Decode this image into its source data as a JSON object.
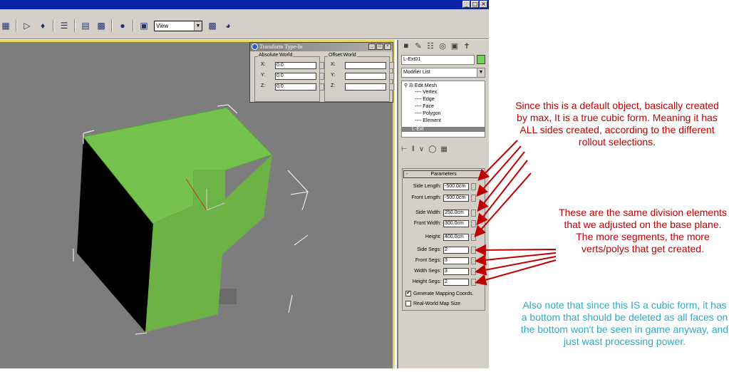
{
  "window": {
    "controls": [
      "_",
      "□",
      "×"
    ]
  },
  "toolbar": {
    "view_dropdown": "View"
  },
  "transform_dialog": {
    "title": "Transform Type-In",
    "absolute_group": "Absolute:World",
    "offset_group": "Offset:World",
    "absolute": [
      {
        "axis": "X:",
        "value": "0.0"
      },
      {
        "axis": "Y:",
        "value": "0.0"
      },
      {
        "axis": "Z:",
        "value": "0.0"
      }
    ],
    "offset": [
      {
        "axis": "X:",
        "value": ""
      },
      {
        "axis": "Y:",
        "value": ""
      },
      {
        "axis": "Z:",
        "value": ""
      }
    ]
  },
  "command_panel": {
    "object_name": "L-Ext01",
    "object_color": "#76d15a",
    "modifier_list": "Modifier List",
    "stack": {
      "edit_mesh": "Edit Mesh",
      "sub_objects": [
        "Vertex",
        "Edge",
        "Face",
        "Polygon",
        "Element"
      ],
      "base_object": "L-Ext"
    },
    "parameters_title": "Parameters",
    "parameters": [
      {
        "label": "Side Length:",
        "value": "-500.0cm"
      },
      {
        "label": "Front Length:",
        "value": "-500.0cm"
      },
      {
        "label": "Side Width:",
        "value": "250.0cm"
      },
      {
        "label": "Front Width:",
        "value": "300.0cm"
      },
      {
        "label": "Height:",
        "value": "400.0cm"
      },
      {
        "label": "Side Segs:",
        "value": "2"
      },
      {
        "label": "Front Segs:",
        "value": "3"
      },
      {
        "label": "Width Segs:",
        "value": "3"
      },
      {
        "label": "Height Segs:",
        "value": "2"
      }
    ],
    "checkboxes": [
      {
        "label": "Generate Mapping Coords.",
        "checked": true,
        "mark": "✔"
      },
      {
        "label": "Real-World Map Size",
        "checked": false,
        "mark": ""
      }
    ]
  },
  "annotations": {
    "note1": "Since this is a default object, basically created by max, It is a true cubic form. Meaning it has ALL sides created, according to the different rollout selections.",
    "note2": "These are the same division elements that we adjusted on the base plane.  The more segments, the more verts/polys that get created.",
    "note3": "Also note that since this IS a cubic form, it has a bottom that should be deleted as all faces on the bottom won't be seen in game anyway, and just wast processing power.",
    "red_color": "#c00000",
    "teal_color": "#30a8c8"
  },
  "viewport": {
    "object_color": "#76c24e",
    "shadow_color": "#000000",
    "background": "#7d7d7d"
  }
}
